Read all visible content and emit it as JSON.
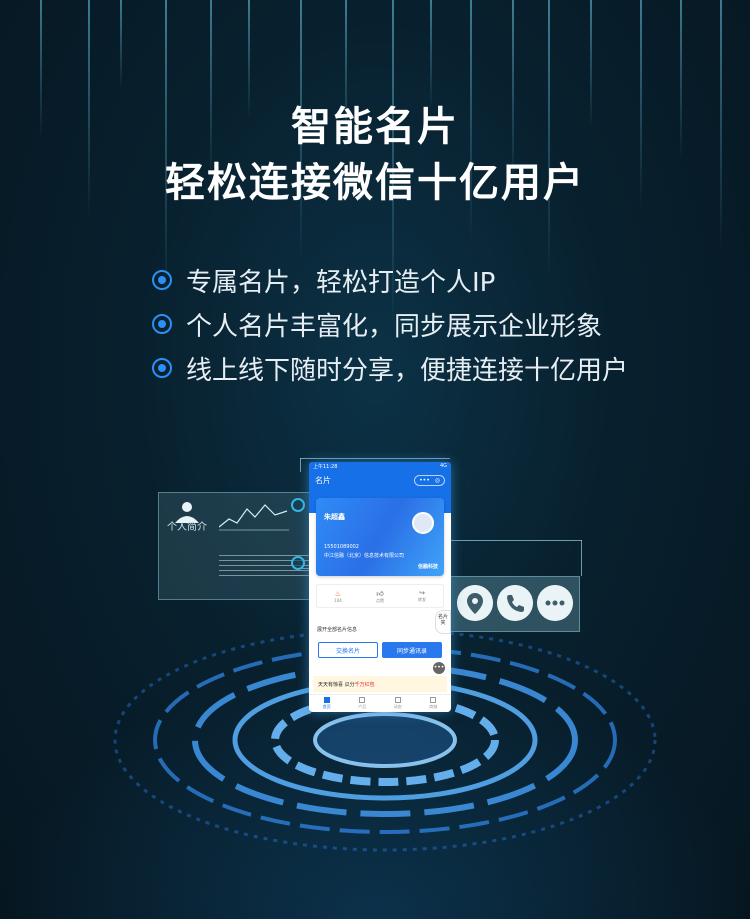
{
  "headline": {
    "line1": "智能名片",
    "line2": "轻松连接微信十亿用户"
  },
  "features": [
    "专属名片，轻松打造个人IP",
    "个人名片丰富化，同步展示企业形象",
    "线上线下随时分享，便捷连接十亿用户"
  ],
  "holo_panel_left": {
    "label": "个人简介",
    "icon": "person-icon"
  },
  "holo_panel_right": {
    "icons": [
      "location-pin-icon",
      "phone-icon",
      "chat-bubble-icon"
    ]
  },
  "phone": {
    "status_time": "上午11:28",
    "status_right": "4G",
    "nav_title": "名片",
    "card": {
      "name": "朱超鑫",
      "phone": "15501089002",
      "company": "中江信融（北京）信息技术有限公司",
      "logo": "信融科技"
    },
    "stats": [
      {
        "value": "",
        "label": "104"
      },
      {
        "value": "",
        "label": "点赞"
      },
      {
        "value": "",
        "label": "转发"
      }
    ],
    "expand_label": "展开全部名片信息",
    "side_tab": "名片夹",
    "buttons": {
      "exchange": "交换名片",
      "sync": "同步通讯录"
    },
    "banner": {
      "text": "天天有惊喜 瓜分",
      "highlight": "千万红包"
    },
    "tabs": [
      "首页",
      "产品",
      "动态",
      "商城"
    ]
  },
  "colors": {
    "accent": "#2b8ff5",
    "phone_blue": "#1670e8",
    "background": "#08202e"
  }
}
